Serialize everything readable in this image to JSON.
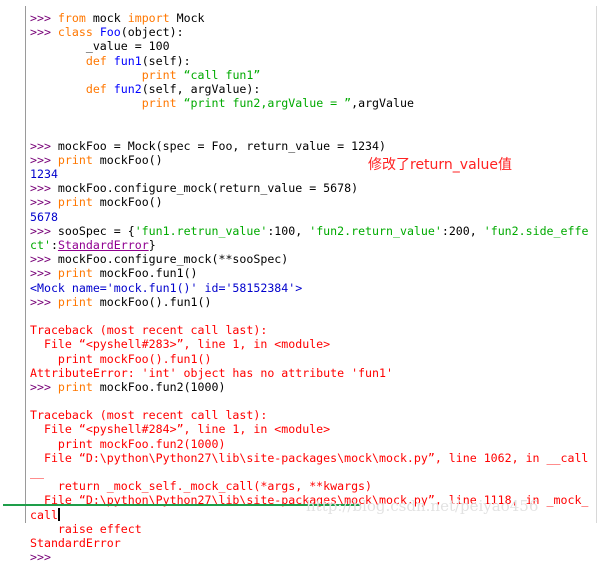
{
  "window": {
    "kind": "python-idle-shell",
    "background": "#ffffff",
    "frame_rule_color": "#9a9a9a"
  },
  "colors": {
    "prompt": "#770077",
    "keyword": "#ff7700",
    "definition": "#0000ff",
    "string": "#00aa00",
    "stdout": "#0000cc",
    "stderr": "#ff0000",
    "builtin": "#900090",
    "plain": "#000000",
    "annotation": "#ff2222",
    "marker_line": "#1e9e4a",
    "watermark": "#e2e2e2"
  },
  "shell": {
    "lines": [
      {
        "id": "l01",
        "segments": [
          {
            "t": ">>> ",
            "c": "prompt"
          },
          {
            "t": "from",
            "c": "kw"
          },
          {
            "t": " mock ",
            "c": "plain"
          },
          {
            "t": "import",
            "c": "kw"
          },
          {
            "t": " Mock",
            "c": "plain"
          }
        ]
      },
      {
        "id": "l02",
        "segments": [
          {
            "t": ">>> ",
            "c": "prompt"
          },
          {
            "t": "class",
            "c": "kw"
          },
          {
            "t": " ",
            "c": "plain"
          },
          {
            "t": "Foo",
            "c": "defname"
          },
          {
            "t": "(object):",
            "c": "plain"
          }
        ]
      },
      {
        "id": "l03",
        "segments": [
          {
            "t": "\t_value = 100",
            "c": "plain"
          }
        ]
      },
      {
        "id": "l04",
        "segments": [
          {
            "t": "\t",
            "c": "plain"
          },
          {
            "t": "def",
            "c": "kw"
          },
          {
            "t": " ",
            "c": "plain"
          },
          {
            "t": "fun1",
            "c": "defname"
          },
          {
            "t": "(self):",
            "c": "plain"
          }
        ]
      },
      {
        "id": "l05",
        "segments": [
          {
            "t": "\t\t",
            "c": "plain"
          },
          {
            "t": "print",
            "c": "kw"
          },
          {
            "t": " ",
            "c": "plain"
          },
          {
            "t": "“call fun1”",
            "c": "str"
          }
        ]
      },
      {
        "id": "l06",
        "segments": [
          {
            "t": "\t",
            "c": "plain"
          },
          {
            "t": "def",
            "c": "kw"
          },
          {
            "t": " ",
            "c": "plain"
          },
          {
            "t": "fun2",
            "c": "defname"
          },
          {
            "t": "(self, argValue):",
            "c": "plain"
          }
        ]
      },
      {
        "id": "l07",
        "segments": [
          {
            "t": "\t\t",
            "c": "plain"
          },
          {
            "t": "print",
            "c": "kw"
          },
          {
            "t": " ",
            "c": "plain"
          },
          {
            "t": "“print fun2,argValue = ”",
            "c": "str"
          },
          {
            "t": ",argValue",
            "c": "plain"
          }
        ]
      },
      {
        "id": "l08",
        "segments": []
      },
      {
        "id": "l09",
        "segments": []
      },
      {
        "id": "l10",
        "segments": [
          {
            "t": ">>> ",
            "c": "prompt"
          },
          {
            "t": "mockFoo = Mock(spec = Foo, return_value = 1234)",
            "c": "plain"
          }
        ]
      },
      {
        "id": "l11",
        "segments": [
          {
            "t": ">>> ",
            "c": "prompt"
          },
          {
            "t": "print",
            "c": "kw"
          },
          {
            "t": " mockFoo()",
            "c": "plain"
          }
        ]
      },
      {
        "id": "l12",
        "segments": [
          {
            "t": "1234",
            "c": "out"
          }
        ]
      },
      {
        "id": "l13",
        "segments": [
          {
            "t": ">>> ",
            "c": "prompt"
          },
          {
            "t": "mockFoo.configure_mock(return_value = 5678)",
            "c": "plain"
          }
        ]
      },
      {
        "id": "l14",
        "segments": [
          {
            "t": ">>> ",
            "c": "prompt"
          },
          {
            "t": "print",
            "c": "kw"
          },
          {
            "t": " mockFoo()",
            "c": "plain"
          }
        ]
      },
      {
        "id": "l15",
        "segments": [
          {
            "t": "5678",
            "c": "out"
          }
        ]
      },
      {
        "id": "l16",
        "segments": [
          {
            "t": ">>> ",
            "c": "prompt"
          },
          {
            "t": "sooSpec = {",
            "c": "plain"
          },
          {
            "t": "'fun1.retrun_value'",
            "c": "str"
          },
          {
            "t": ":100, ",
            "c": "plain"
          },
          {
            "t": "'fun2.return_value'",
            "c": "str"
          },
          {
            "t": ":200, ",
            "c": "plain"
          },
          {
            "t": "'fun2.side_effe",
            "c": "str"
          }
        ]
      },
      {
        "id": "l17",
        "segments": [
          {
            "t": "ct'",
            "c": "str"
          },
          {
            "t": ":",
            "c": "plain"
          },
          {
            "t": "StandardError",
            "c": "builtin"
          },
          {
            "t": "}",
            "c": "plain"
          }
        ]
      },
      {
        "id": "l18",
        "segments": [
          {
            "t": ">>> ",
            "c": "prompt"
          },
          {
            "t": "mockFoo.configure_mock(**sooSpec)",
            "c": "plain"
          }
        ]
      },
      {
        "id": "l19",
        "segments": [
          {
            "t": ">>> ",
            "c": "prompt"
          },
          {
            "t": "print",
            "c": "kw"
          },
          {
            "t": " mockFoo.fun1()",
            "c": "plain"
          }
        ]
      },
      {
        "id": "l20",
        "segments": [
          {
            "t": "<Mock name='mock.fun1()' id='58152384'>",
            "c": "out"
          }
        ]
      },
      {
        "id": "l21",
        "segments": [
          {
            "t": ">>> ",
            "c": "prompt"
          },
          {
            "t": "print",
            "c": "kw"
          },
          {
            "t": " mockFoo().fun1()",
            "c": "plain"
          }
        ]
      },
      {
        "id": "l22",
        "segments": []
      },
      {
        "id": "l23",
        "segments": [
          {
            "t": "Traceback (most recent call last):",
            "c": "err"
          }
        ]
      },
      {
        "id": "l24",
        "segments": [
          {
            "t": "  File “<pyshell#283>”, line 1, in <module>",
            "c": "err"
          }
        ]
      },
      {
        "id": "l25",
        "segments": [
          {
            "t": "    print mockFoo().fun1()",
            "c": "err"
          }
        ]
      },
      {
        "id": "l26",
        "segments": [
          {
            "t": "AttributeError: 'int' object has no attribute 'fun1'",
            "c": "err"
          }
        ]
      },
      {
        "id": "l27",
        "segments": [
          {
            "t": ">>> ",
            "c": "prompt"
          },
          {
            "t": "print",
            "c": "kw"
          },
          {
            "t": " mockFoo.fun2(1000)",
            "c": "plain"
          }
        ]
      },
      {
        "id": "l28",
        "segments": []
      },
      {
        "id": "l29",
        "segments": [
          {
            "t": "Traceback (most recent call last):",
            "c": "err"
          }
        ]
      },
      {
        "id": "l30",
        "segments": [
          {
            "t": "  File “<pyshell#284>”, line 1, in <module>",
            "c": "err"
          }
        ]
      },
      {
        "id": "l31",
        "segments": [
          {
            "t": "    print mockFoo.fun2(1000)",
            "c": "err"
          }
        ]
      },
      {
        "id": "l32",
        "segments": [
          {
            "t": "  File “D:\\python\\Python27\\lib\\site-packages\\mock\\mock.py”, line 1062, in __call",
            "c": "err"
          }
        ]
      },
      {
        "id": "l33",
        "segments": [
          {
            "t": "__",
            "c": "err"
          }
        ]
      },
      {
        "id": "l34",
        "segments": [
          {
            "t": "    return _mock_self._mock_call(*args, **kwargs)",
            "c": "err"
          }
        ]
      },
      {
        "id": "l35",
        "segments": [
          {
            "t": "  File “D:\\python\\Python27\\lib\\site-packages\\mock\\mock.py”, line 1118, in _mock_",
            "c": "err"
          }
        ]
      },
      {
        "id": "l36",
        "segments": [
          {
            "t": "call",
            "c": "err"
          }
        ]
      },
      {
        "id": "l37",
        "segments": [
          {
            "t": "    raise effect",
            "c": "err"
          }
        ]
      },
      {
        "id": "l38",
        "segments": [
          {
            "t": "StandardError",
            "c": "err"
          }
        ]
      },
      {
        "id": "l39",
        "segments": [
          {
            "t": ">>> ",
            "c": "prompt"
          }
        ]
      }
    ]
  },
  "annotation": {
    "text": "修改了return_value值"
  },
  "watermark": {
    "text": "http://blog.csdn.net/peiyao456"
  }
}
